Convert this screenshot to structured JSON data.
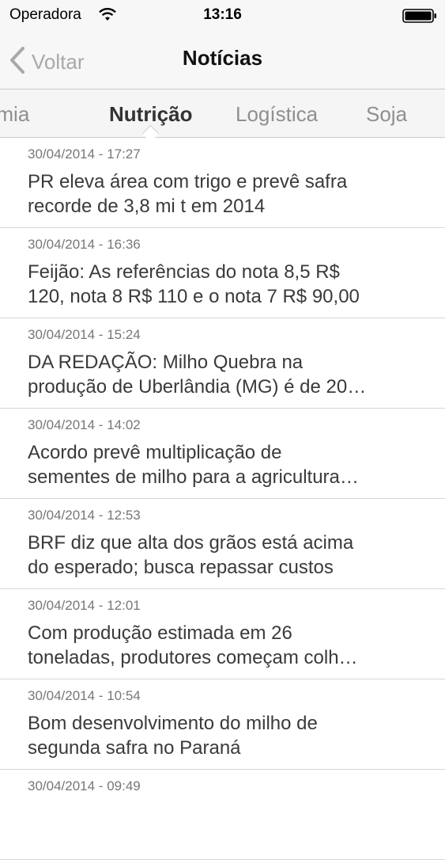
{
  "status_bar": {
    "carrier": "Operadora",
    "time": "13:16"
  },
  "nav": {
    "back_label": "Voltar",
    "title": "Notícias"
  },
  "tabs": [
    {
      "label": "onomia",
      "active": false
    },
    {
      "label": "Nutrição",
      "active": true
    },
    {
      "label": "Logística",
      "active": false
    },
    {
      "label": "Soja",
      "active": false
    }
  ],
  "news": [
    {
      "date": "30/04/2014 - 17:27",
      "line1": "PR eleva área com trigo e prevê safra",
      "line2": "recorde de 3,8 mi t em 2014"
    },
    {
      "date": "30/04/2014 - 16:36",
      "line1": "Feijão: As referências do nota 8,5 R$",
      "line2": "120, nota 8 R$ 110 e o nota 7 R$ 90,00"
    },
    {
      "date": "30/04/2014 - 15:24",
      "line1": "DA REDAÇÃO: Milho  Quebra na",
      "line2": "produção de Uberlândia (MG) é de 20…"
    },
    {
      "date": "30/04/2014 - 14:02",
      "line1": "Acordo prevê multiplicação de",
      "line2": "sementes de milho para a agricultura…"
    },
    {
      "date": "30/04/2014 - 12:53",
      "line1": "BRF diz que alta dos grãos está acima",
      "line2": "do esperado; busca repassar custos"
    },
    {
      "date": "30/04/2014 - 12:01",
      "line1": "Com produção estimada em 26",
      "line2": "toneladas, produtores começam colh…"
    },
    {
      "date": "30/04/2014 - 10:54",
      "line1": "Bom desenvolvimento do milho de",
      "line2": "segunda safra no Paraná"
    },
    {
      "date": "30/04/2014 - 09:49",
      "line1": "",
      "line2": ""
    }
  ]
}
